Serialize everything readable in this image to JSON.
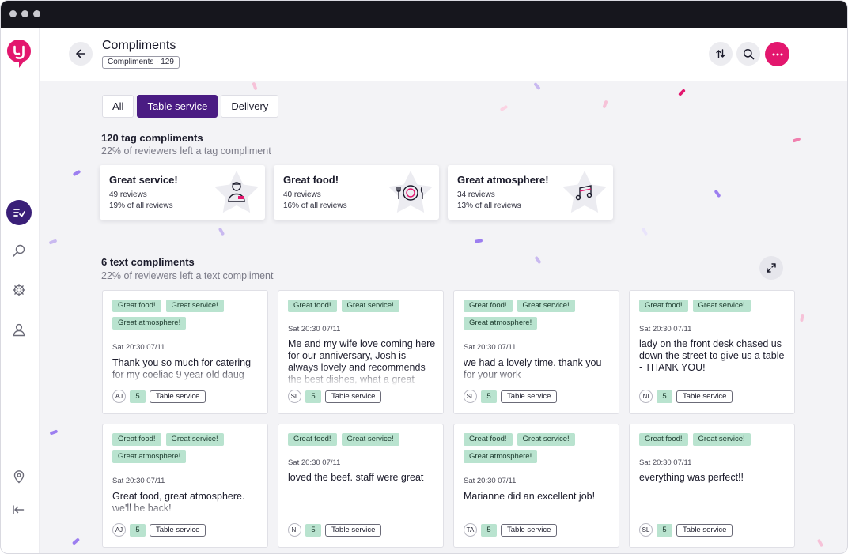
{
  "colors": {
    "brand_pink": "#e3176e",
    "brand_purple": "#4a1c83",
    "chip_green": "#b9e3cf"
  },
  "sidebar": {
    "logo": "yogiyo-logo",
    "items": [
      {
        "icon": "list-check-icon",
        "active": true
      },
      {
        "icon": "search-icon",
        "active": false
      },
      {
        "icon": "gear-icon",
        "active": false
      },
      {
        "icon": "user-icon",
        "active": false
      },
      {
        "icon": "location-pin-icon",
        "active": false
      },
      {
        "icon": "collapse-icon",
        "active": false
      }
    ]
  },
  "header": {
    "title": "Compliments",
    "count_chip": "Compliments · 129",
    "icons": [
      "sort-icon",
      "search-icon",
      "more-icon"
    ]
  },
  "tabs": [
    {
      "label": "All",
      "active": false
    },
    {
      "label": "Table service",
      "active": true
    },
    {
      "label": "Delivery",
      "active": false
    }
  ],
  "tag_section": {
    "title": "120 tag compliments",
    "subtitle": "22% of reviewers left a tag compliment",
    "cards": [
      {
        "title": "Great service!",
        "reviews": "49 reviews",
        "percent": "19% of all reviews",
        "icon": "waiter-icon"
      },
      {
        "title": "Great food!",
        "reviews": "40 reviews",
        "percent": "16% of all reviews",
        "icon": "plate-icon"
      },
      {
        "title": "Great atmosphere!",
        "reviews": "34 reviews",
        "percent": "13% of all reviews",
        "icon": "music-note-icon"
      }
    ]
  },
  "text_section": {
    "title": "6 text compliments",
    "subtitle": "22% of reviewers left a text compliment",
    "reviews": [
      {
        "tags": [
          "Great food!",
          "Great service!",
          "Great atmosphere!"
        ],
        "date": "Sat 20:30 07/11",
        "text": "Thank you so much for catering for my coeliac 9 year old daug",
        "initials": "AJ",
        "score": "5",
        "service": "Table service"
      },
      {
        "tags": [
          "Great food!",
          "Great service!"
        ],
        "date": "Sat 20:30 07/11",
        "text": "Me and my wife love coming here for our anniversary, Josh is always lovely and recommends the best dishes, what a great",
        "initials": "SL",
        "score": "5",
        "service": "Table service"
      },
      {
        "tags": [
          "Great food!",
          "Great service!",
          "Great atmosphere!"
        ],
        "date": "Sat 20:30 07/11",
        "text": "we had a lovely time. thank you for your work",
        "initials": "SL",
        "score": "5",
        "service": "Table service"
      },
      {
        "tags": [
          "Great food!",
          "Great service!"
        ],
        "date": "Sat 20:30 07/11",
        "text": "lady on the front desk chased us down the street to give us a table - THANK YOU!",
        "initials": "NI",
        "score": "5",
        "service": "Table service"
      },
      {
        "tags": [
          "Great food!",
          "Great service!",
          "Great atmosphere!"
        ],
        "date": "Sat 20:30 07/11",
        "text": "Great food, great atmosphere. we'll be back!",
        "initials": "AJ",
        "score": "5",
        "service": "Table service"
      },
      {
        "tags": [
          "Great food!",
          "Great service!"
        ],
        "date": "Sat 20:30 07/11",
        "text": "loved the beef. staff were great",
        "initials": "NI",
        "score": "5",
        "service": "Table service"
      },
      {
        "tags": [
          "Great food!",
          "Great service!",
          "Great atmosphere!"
        ],
        "date": "Sat 20:30 07/11",
        "text": "Marianne did an excellent job!",
        "initials": "TA",
        "score": "5",
        "service": "Table service"
      },
      {
        "tags": [
          "Great food!",
          "Great service!"
        ],
        "date": "Sat 20:30 07/11",
        "text": "everything was perfect!!",
        "initials": "SL",
        "score": "5",
        "service": "Table service"
      }
    ]
  }
}
